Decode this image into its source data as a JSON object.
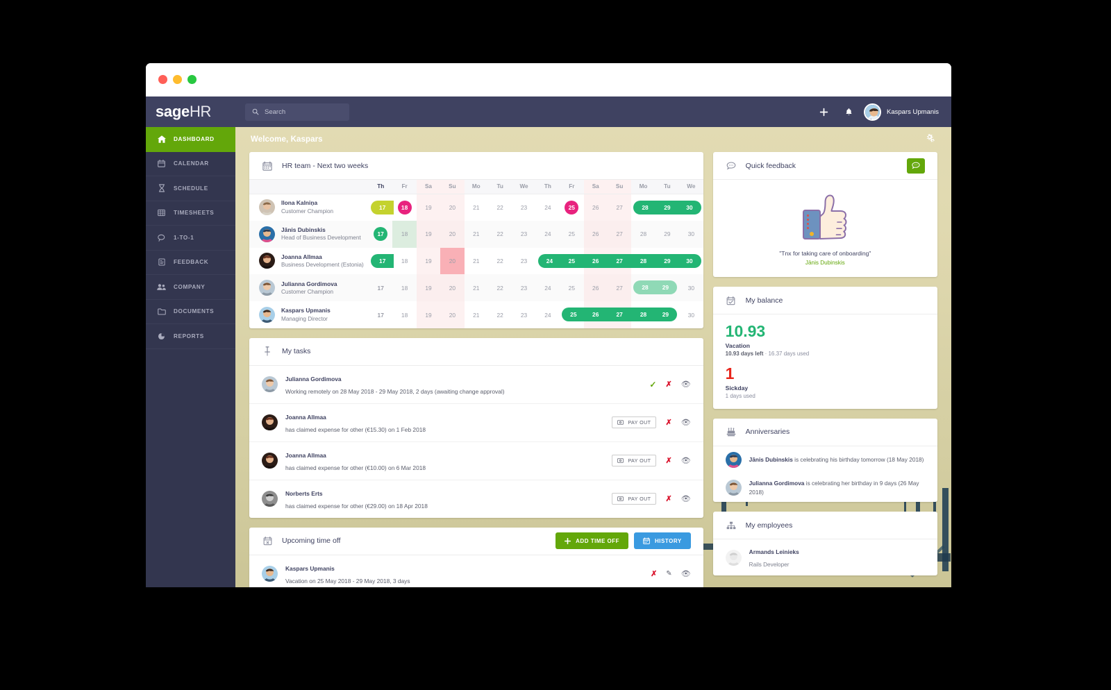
{
  "window": {
    "title": "Sage HR Dashboard"
  },
  "topnav": {
    "brand_bold": "sage",
    "brand_light": "HR",
    "search_placeholder": "Search",
    "search_value": "",
    "add_icon": "plus-icon",
    "bell_icon": "bell-icon",
    "user_name": "Kaspars Upmanis"
  },
  "sidebar": {
    "items": [
      {
        "label": "DASHBOARD",
        "icon": "home-icon",
        "active": true
      },
      {
        "label": "CALENDAR",
        "icon": "calendar-icon",
        "active": false
      },
      {
        "label": "SCHEDULE",
        "icon": "hourglass-icon",
        "active": false
      },
      {
        "label": "TIMESHEETS",
        "icon": "grid-icon",
        "active": false
      },
      {
        "label": "1-TO-1",
        "icon": "chat-icon",
        "active": false
      },
      {
        "label": "FEEDBACK",
        "icon": "note-icon",
        "active": false
      },
      {
        "label": "COMPANY",
        "icon": "people-icon",
        "active": false
      },
      {
        "label": "DOCUMENTS",
        "icon": "folder-icon",
        "active": false
      },
      {
        "label": "REPORTS",
        "icon": "pie-icon",
        "active": false
      }
    ]
  },
  "welcome": {
    "title": "Welcome, Kaspars",
    "gear_icon": "gears-icon"
  },
  "team_calendar": {
    "title": "HR team - Next two weeks",
    "icon": "calendar-icon",
    "day_labels": [
      "Th",
      "Fr",
      "Sa",
      "Su",
      "Mo",
      "Tu",
      "We",
      "Th",
      "Fr",
      "Sa",
      "Su",
      "Mo",
      "Tu",
      "We"
    ],
    "dates": [
      17,
      18,
      19,
      20,
      21,
      22,
      23,
      24,
      25,
      26,
      27,
      28,
      29,
      30
    ],
    "today_index": 0,
    "weekend_indexes": [
      2,
      3,
      9,
      10
    ],
    "rows": [
      {
        "name": "Ilona Kalniņa",
        "role": "Customer Champion",
        "avatar": "avatar-ilona",
        "cells": [
          {
            "d": 17,
            "style": "lime-halfleft"
          },
          {
            "d": 18,
            "style": "pink-circle"
          },
          {
            "d": 19,
            "style": "plain"
          },
          {
            "d": 20,
            "style": "plain"
          },
          {
            "d": 21,
            "style": "plain"
          },
          {
            "d": 22,
            "style": "plain"
          },
          {
            "d": 23,
            "style": "plain"
          },
          {
            "d": 24,
            "style": "plain"
          },
          {
            "d": 25,
            "style": "pink-circle"
          },
          {
            "d": 26,
            "style": "plain"
          },
          {
            "d": 27,
            "style": "plain"
          },
          {
            "d": 28,
            "style": "green-start"
          },
          {
            "d": 29,
            "style": "green-mid"
          },
          {
            "d": 30,
            "style": "green-end"
          }
        ]
      },
      {
        "name": "Jānis Dubinskis",
        "role": "Head of Business Development",
        "avatar": "avatar-janis",
        "cells": [
          {
            "d": 17,
            "style": "green-circle"
          },
          {
            "d": 18,
            "style": "cellbg-green"
          },
          {
            "d": 19,
            "style": "plain"
          },
          {
            "d": 20,
            "style": "plain"
          },
          {
            "d": 21,
            "style": "plain"
          },
          {
            "d": 22,
            "style": "plain"
          },
          {
            "d": 23,
            "style": "plain"
          },
          {
            "d": 24,
            "style": "plain"
          },
          {
            "d": 25,
            "style": "plain"
          },
          {
            "d": 26,
            "style": "plain"
          },
          {
            "d": 27,
            "style": "plain"
          },
          {
            "d": 28,
            "style": "plain"
          },
          {
            "d": 29,
            "style": "plain"
          },
          {
            "d": 30,
            "style": "plain"
          }
        ]
      },
      {
        "name": "Joanna Allmaa",
        "role": "Business Development (Estonia)",
        "avatar": "avatar-joanna",
        "cells": [
          {
            "d": 17,
            "style": "green-halfleft"
          },
          {
            "d": 18,
            "style": "plain"
          },
          {
            "d": 19,
            "style": "plain"
          },
          {
            "d": 20,
            "style": "cellbg-pink"
          },
          {
            "d": 21,
            "style": "plain"
          },
          {
            "d": 22,
            "style": "plain"
          },
          {
            "d": 23,
            "style": "plain"
          },
          {
            "d": 24,
            "style": "green-start"
          },
          {
            "d": 25,
            "style": "green-mid"
          },
          {
            "d": 26,
            "style": "green-mid"
          },
          {
            "d": 27,
            "style": "green-mid"
          },
          {
            "d": 28,
            "style": "green-mid"
          },
          {
            "d": 29,
            "style": "green-mid"
          },
          {
            "d": 30,
            "style": "green-end"
          }
        ]
      },
      {
        "name": "Julianna Gordimova",
        "role": "Customer Champion",
        "avatar": "avatar-julianna",
        "cells": [
          {
            "d": 17,
            "style": "today-plain"
          },
          {
            "d": 18,
            "style": "plain"
          },
          {
            "d": 19,
            "style": "plain"
          },
          {
            "d": 20,
            "style": "plain"
          },
          {
            "d": 21,
            "style": "plain"
          },
          {
            "d": 22,
            "style": "plain"
          },
          {
            "d": 23,
            "style": "plain"
          },
          {
            "d": 24,
            "style": "plain"
          },
          {
            "d": 25,
            "style": "plain"
          },
          {
            "d": 26,
            "style": "cellbg-lgreen"
          },
          {
            "d": 27,
            "style": "plain"
          },
          {
            "d": 28,
            "style": "light-start"
          },
          {
            "d": 29,
            "style": "light-end"
          },
          {
            "d": 30,
            "style": "plain"
          }
        ]
      },
      {
        "name": "Kaspars Upmanis",
        "role": "Managing Director",
        "avatar": "avatar-kaspars",
        "cells": [
          {
            "d": 17,
            "style": "today-plain"
          },
          {
            "d": 18,
            "style": "plain"
          },
          {
            "d": 19,
            "style": "plain"
          },
          {
            "d": 20,
            "style": "plain"
          },
          {
            "d": 21,
            "style": "plain"
          },
          {
            "d": 22,
            "style": "plain"
          },
          {
            "d": 23,
            "style": "plain"
          },
          {
            "d": 24,
            "style": "plain"
          },
          {
            "d": 25,
            "style": "green-start"
          },
          {
            "d": 26,
            "style": "green-mid"
          },
          {
            "d": 27,
            "style": "green-mid"
          },
          {
            "d": 28,
            "style": "green-mid"
          },
          {
            "d": 29,
            "style": "green-end"
          },
          {
            "d": 30,
            "style": "plain"
          }
        ]
      }
    ]
  },
  "my_tasks": {
    "title": "My tasks",
    "icon": "pin-icon",
    "payout_label": "PAY OUT",
    "rows": [
      {
        "name": "Julianna Gordimova",
        "desc": "Working remotely on 28 May 2018 - 29 May 2018, 2 days (awaiting change approval)",
        "avatar": "avatar-julianna",
        "actions": [
          "approve-check",
          "reject-x",
          "view-eye"
        ]
      },
      {
        "name": "Joanna Allmaa",
        "desc": "has claimed expense for other (€15.30) on 1 Feb 2018",
        "avatar": "avatar-joanna",
        "actions": [
          "pay-out",
          "reject-x",
          "view-eye"
        ]
      },
      {
        "name": "Joanna Allmaa",
        "desc": "has claimed expense for other (€10.00) on 6 Mar 2018",
        "avatar": "avatar-joanna",
        "actions": [
          "pay-out",
          "reject-x",
          "view-eye"
        ]
      },
      {
        "name": "Norberts Erts",
        "desc": "has claimed expense for other (€29.00) on 18 Apr 2018",
        "avatar": "avatar-norberts",
        "actions": [
          "pay-out",
          "reject-x",
          "view-eye"
        ]
      }
    ]
  },
  "upcoming_time_off": {
    "title": "Upcoming time off",
    "icon": "calendar-x-icon",
    "add_label": "ADD TIME OFF",
    "history_label": "HISTORY",
    "rows": [
      {
        "name": "Kaspars Upmanis",
        "desc": "Vacation on 25 May 2018 - 29 May 2018, 3 days",
        "avatar": "avatar-kaspars",
        "actions": [
          "reject-x",
          "edit-pen",
          "view-eye"
        ]
      }
    ]
  },
  "quick_feedback": {
    "title": "Quick feedback",
    "icon": "speech-bubble-icon",
    "button_icon": "speech-bubble-icon",
    "illustration": "thumbs-up-illustration",
    "quote": "\"Tnx for taking care of onboarding\"",
    "author": "Jānis Dubinskis"
  },
  "my_balance": {
    "title": "My balance",
    "icon": "calendar-check-icon",
    "entries": [
      {
        "value": "10.93",
        "color": "#23b574",
        "label": "Vacation",
        "sub_strong": "10.93 days left",
        "sub_rest": " · 16.37 days used"
      },
      {
        "value": "1",
        "color": "#e8261c",
        "label": "Sickday",
        "sub_strong": "",
        "sub_rest": "1 days used"
      }
    ]
  },
  "anniversaries": {
    "title": "Anniversaries",
    "icon": "cake-icon",
    "rows": [
      {
        "avatar": "avatar-janis",
        "who": "Jānis Dubinskis",
        "text": " is celebrating his birthday tomorrow (18 May 2018)"
      },
      {
        "avatar": "avatar-julianna",
        "who": "Julianna Gordimova",
        "text": " is celebrating her birthday in 9 days (26 May 2018)"
      }
    ]
  },
  "my_employees": {
    "title": "My employees",
    "icon": "org-chart-icon",
    "rows": [
      {
        "avatar": "avatar-armands",
        "name": "Armands Leinieks",
        "role": "Rails Developer"
      }
    ]
  },
  "colors": {
    "brand_green": "#63a70a",
    "nav_dark": "#3f4261",
    "sidebar_dark": "#33364f",
    "accent_teal": "#23b574",
    "accent_pink": "#e8227e",
    "accent_lime": "#c4d22e",
    "accent_blue": "#3a9ae0",
    "danger_red": "#d9122b"
  }
}
